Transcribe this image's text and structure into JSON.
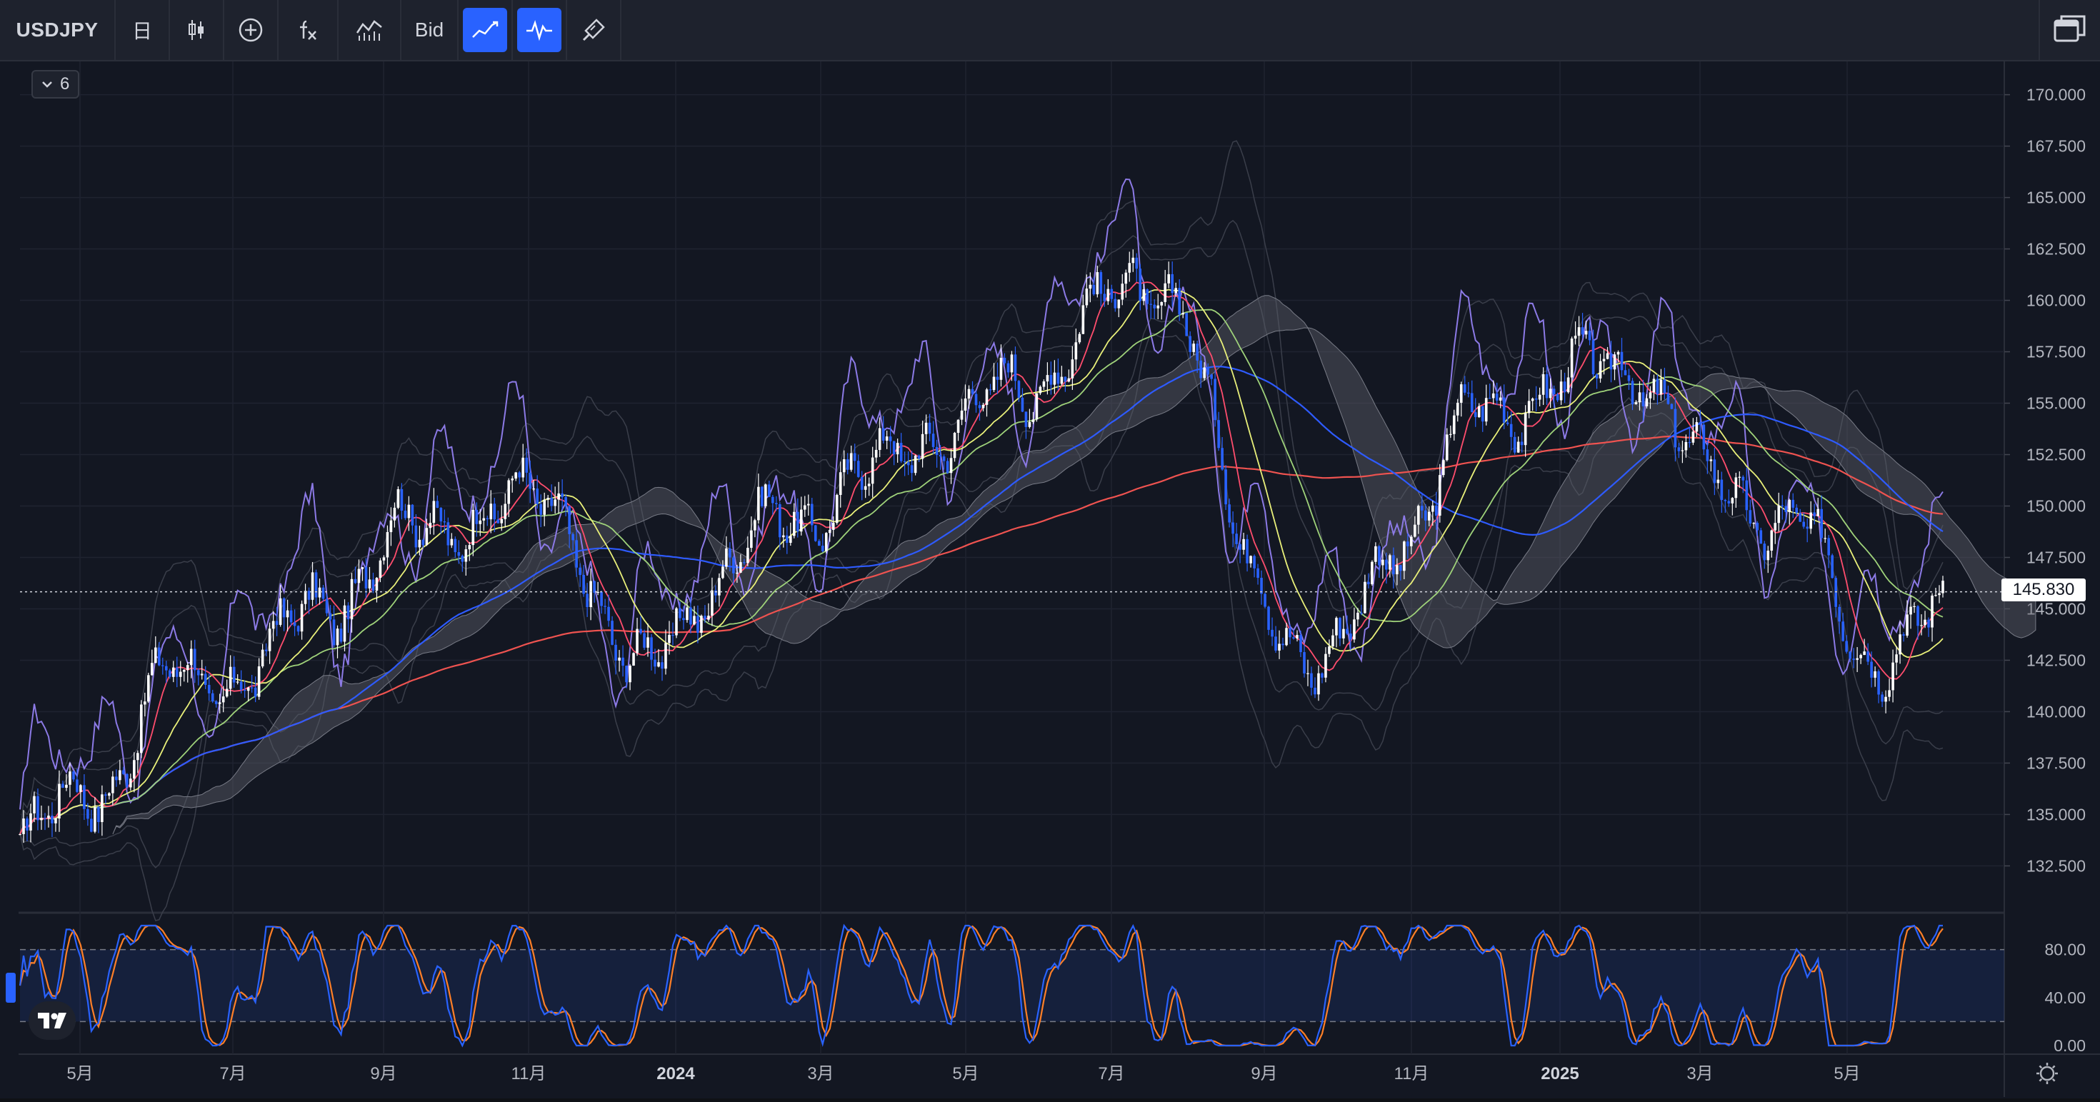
{
  "toolbar": {
    "symbol": "USDJPY",
    "interval": "日",
    "bid_label": "Bid",
    "icons": [
      "candlestick-icon",
      "add-circle-icon",
      "indicator-fx-icon",
      "compare-chart-icon",
      "line-chart-icon",
      "pulse-chart-icon",
      "brush-icon",
      "window-layout-icon"
    ]
  },
  "legend": {
    "count": "6"
  },
  "price_axis": {
    "labels": [
      "170.000",
      "167.500",
      "165.000",
      "162.500",
      "160.000",
      "157.500",
      "155.000",
      "152.500",
      "150.000",
      "147.500",
      "145.000",
      "142.500",
      "140.000",
      "137.500",
      "135.000",
      "132.500"
    ],
    "current_price": "145.830"
  },
  "oscillator_axis": {
    "labels": [
      "80.00",
      "40.00",
      "0.00"
    ]
  },
  "time_axis": {
    "labels": [
      "5月",
      "7月",
      "9月",
      "11月",
      "2024",
      "3月",
      "5月",
      "7月",
      "9月",
      "11月",
      "2025",
      "3月",
      "5月"
    ]
  },
  "colors": {
    "background": "#131722",
    "candle_up": "#ffffff",
    "candle_down": "#2962ff",
    "ma_fast": "#ff4d6d",
    "ma_mid": "#e9f07a",
    "ma_green": "#9fd27a",
    "ma_blue": "#2e5bff",
    "ma_slow": "#ef5350",
    "rci": "#8c7ae6",
    "stoch_k": "#2962ff",
    "stoch_d": "#ff7f27"
  },
  "chart_data": {
    "type": "line",
    "title": "",
    "ylim": [
      130.5,
      171.0
    ],
    "x": [
      "2023-04",
      "2023-05",
      "2023-06",
      "2023-07",
      "2023-08",
      "2023-09",
      "2023-10",
      "2023-11",
      "2023-12",
      "2024-01",
      "2024-02",
      "2024-03",
      "2024-04",
      "2024-05",
      "2024-06",
      "2024-07",
      "2024-08",
      "2024-09",
      "2024-10",
      "2024-11",
      "2024-12",
      "2025-01",
      "2025-02",
      "2025-03",
      "2025-04",
      "2025-05"
    ],
    "series": [
      {
        "values": [
          133.5,
          136.5,
          141.5,
          142.0,
          145.5,
          148.5,
          149.8,
          150.0,
          141.5,
          146.5,
          149.5,
          151.3,
          154.0,
          155.5,
          159.5,
          161.0,
          146.5,
          142.0,
          149.0,
          154.5,
          156.0,
          157.0,
          151.0,
          149.5,
          143.0,
          144.5
        ]
      }
    ],
    "current_price": 145.83
  }
}
